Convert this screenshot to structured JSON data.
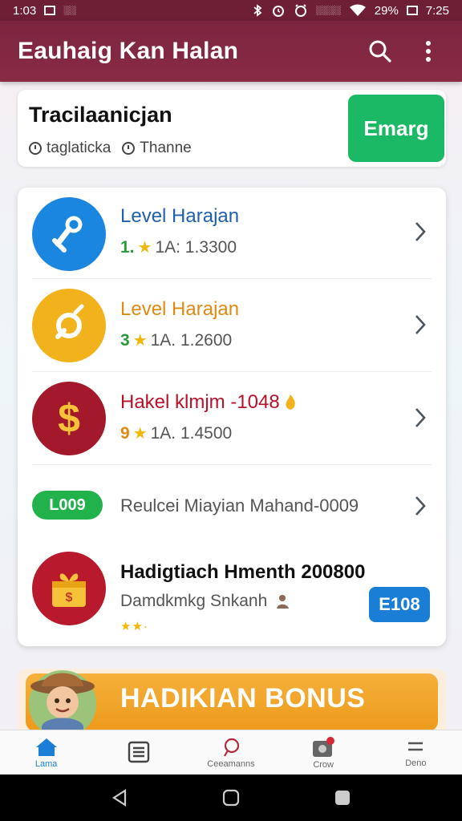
{
  "status_bar": {
    "time": "1:03",
    "left_text": "░░",
    "carrier": "░░░░",
    "battery": "29%",
    "clock_right": "7:25"
  },
  "app_bar": {
    "title": "Eauhaig Kan Halan",
    "icons": [
      "search-icon",
      "more-vert-icon"
    ]
  },
  "top_card": {
    "title": "Tracilaanicjan",
    "meta_1": "taglaticka",
    "meta_2": "Thanne",
    "button_label": "Emarg"
  },
  "list": {
    "rows": [
      {
        "title": "Level Harajan",
        "rank": "1.",
        "stats": "1A: 1.3300",
        "title_color": "#1f5fae",
        "icon": "key-icon",
        "avatar_color": "#1a86e0"
      },
      {
        "title": "Level Harajan",
        "rank": "3",
        "stats": "1A. 1.2600",
        "title_color": "#e08a12",
        "icon": "coin-icon",
        "avatar_color": "#f2b21c"
      },
      {
        "title": "Hakel klmjm -1048",
        "rank": "9",
        "stats": "1A. 1.4500",
        "title_color": "#b7122a",
        "icon": "dollar-icon",
        "avatar_color": "#a3182b"
      }
    ],
    "pill_row": {
      "pill_label": "L009",
      "text": "Reulcei Miayian Mahand-0009"
    },
    "gift_row": {
      "title": "Hadigtiach Hmenth 200800",
      "subtitle": "Damdkmkg Snkanh",
      "button_label": "E108"
    }
  },
  "bonus": {
    "label": "HADIKIAN BONUS"
  },
  "bottom_nav": {
    "items": [
      {
        "label": "Lama",
        "icon": "home-icon"
      },
      {
        "label": "",
        "icon": "list-icon"
      },
      {
        "label": "Ceeamanns",
        "icon": "chat-icon"
      },
      {
        "label": "Crow",
        "icon": "inbox-icon"
      },
      {
        "label": "Deno",
        "icon": "menu-icon"
      }
    ]
  },
  "colors": {
    "app_bar": "#7b2540",
    "accent_green": "#1bb865",
    "accent_blue": "#1a7ed6",
    "bonus_orange": "#f2a62c"
  }
}
